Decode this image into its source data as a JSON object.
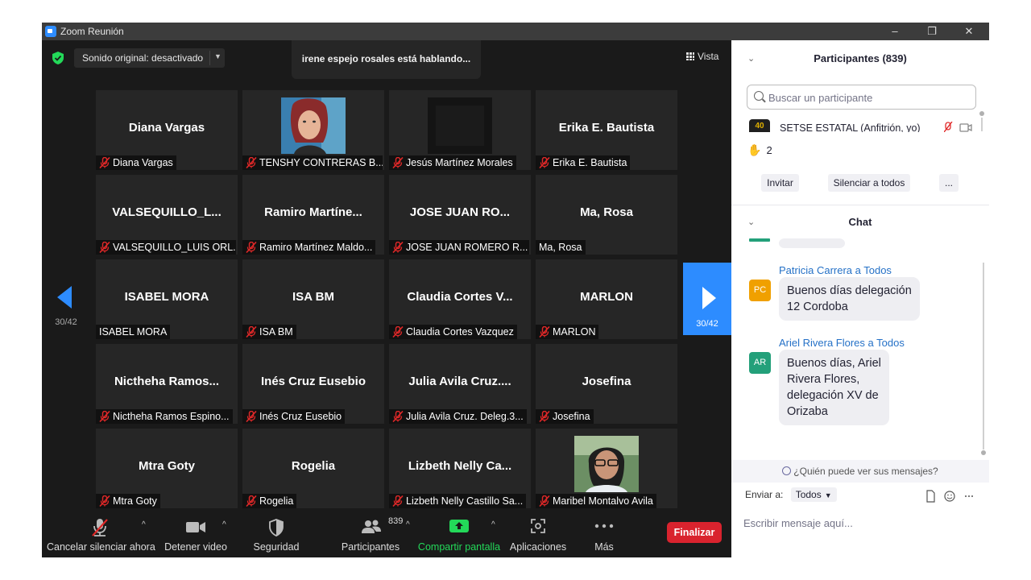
{
  "window": {
    "title": "Zoom Reunión",
    "minimize": "–",
    "maximize": "❐",
    "close": "✕"
  },
  "meeting": {
    "audio_label": "Sonido original: desactivado",
    "speaking": "irene espejo rosales está hablando...",
    "view_label": "Vista",
    "page_prev": "30/42",
    "page_next": "30/42"
  },
  "tiles": [
    {
      "big": "Diana Vargas",
      "tag": "Diana Vargas",
      "muted": true
    },
    {
      "big": "",
      "tag": "TENSHY CONTRERAS B...",
      "muted": true,
      "photo": "woman-portrait-red-hair"
    },
    {
      "big": "",
      "tag": "Jesús Martínez Morales",
      "muted": true,
      "photo": "dark-video"
    },
    {
      "big": "Erika E. Bautista",
      "tag": "Erika E. Bautista",
      "muted": true
    },
    {
      "big": "VALSEQUILLO_L...",
      "tag": "VALSEQUILLO_LUIS ORL...",
      "muted": true
    },
    {
      "big": "Ramiro  Martíne...",
      "tag": "Ramiro Martínez Maldo...",
      "muted": true
    },
    {
      "big": "JOSE JUAN RO...",
      "tag": "JOSE JUAN ROMERO R...",
      "muted": true
    },
    {
      "big": "Ma, Rosa",
      "tag": "Ma, Rosa",
      "muted": false
    },
    {
      "big": "ISABEL MORA",
      "tag": "ISABEL MORA",
      "muted": false
    },
    {
      "big": "ISA BM",
      "tag": "ISA BM",
      "muted": true
    },
    {
      "big": "Claudia  Cortes  V...",
      "tag": "Claudia Cortes Vazquez",
      "muted": true
    },
    {
      "big": "MARLON",
      "tag": "MARLON",
      "muted": true
    },
    {
      "big": "Nictheha  Ramos...",
      "tag": "Nictheha Ramos Espino...",
      "muted": true
    },
    {
      "big": "Inés Cruz Eusebio",
      "tag": "Inés Cruz Eusebio",
      "muted": true
    },
    {
      "big": "Julia  Avila  Cruz....",
      "tag": "Julia Avila Cruz. Deleg.3...",
      "muted": true
    },
    {
      "big": "Josefina",
      "tag": "Josefina",
      "muted": true
    },
    {
      "big": "Mtra Goty",
      "tag": "Mtra Goty",
      "muted": true
    },
    {
      "big": "Rogelia",
      "tag": "Rogelia",
      "muted": true
    },
    {
      "big": "Lizbeth  Nelly  Ca...",
      "tag": "Lizbeth Nelly Castillo Sa...",
      "muted": true
    },
    {
      "big": "",
      "tag": "Maribel Montalvo Avila",
      "muted": true,
      "photo": "woman-portrait-glasses"
    }
  ],
  "toolbar": {
    "unmute": "Cancelar silenciar ahora",
    "video": "Detener video",
    "security": "Seguridad",
    "participants": "Participantes",
    "participants_count": "839",
    "share": "Compartir pantalla",
    "apps": "Aplicaciones",
    "more": "Más",
    "end": "Finalizar"
  },
  "participants_panel": {
    "title": "Participantes (839)",
    "search_placeholder": "Buscar un participante",
    "host_name": "SETSE ESTATAL (Anfitrión, yo)",
    "host_avatar_text": "40",
    "raised_hands": "2",
    "invite": "Invitar",
    "mute_all": "Silenciar a todos",
    "more": "..."
  },
  "chat": {
    "title": "Chat",
    "messages": [
      {
        "sender": "Patricia Carrera a Todos",
        "initials": "PC",
        "color": "#f0a000",
        "lines": [
          "Buenos días delegación",
          "12 Cordoba"
        ]
      },
      {
        "sender": "Ariel Rivera Flores a Todos",
        "initials": "AR",
        "color": "#23a07a",
        "lines": [
          "Buenos días, Ariel",
          "Rivera Flores,",
          "delegación XV de",
          "Orizaba"
        ]
      }
    ],
    "who_can_see": "¿Quién puede ver sus mensajes?",
    "send_to_label": "Enviar a:",
    "send_to_value": "Todos",
    "input_placeholder": "Escribir mensaje aquí..."
  },
  "colors": {
    "accent": "#2d8cff",
    "end_red": "#d9232e",
    "share_green": "#23d959",
    "mute_red": "#e02828"
  }
}
